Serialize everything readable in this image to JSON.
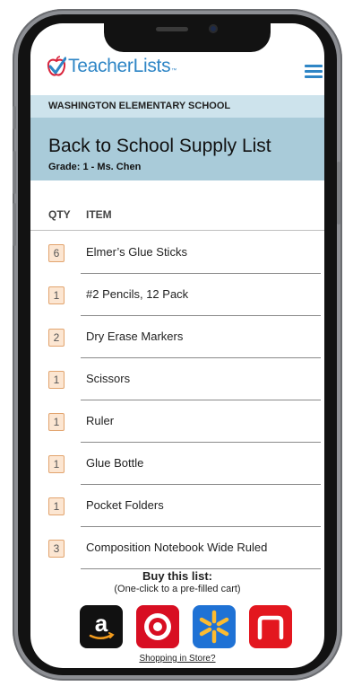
{
  "header": {
    "logo_name": "TeacherLists",
    "logo_tm": "™"
  },
  "school": "WASHINGTON ELEMENTARY SCHOOL",
  "list": {
    "title": "Back to School Supply List",
    "grade": "Grade: 1 - Ms. Chen"
  },
  "columns": {
    "qty": "QTY",
    "item": "ITEM"
  },
  "items": [
    {
      "qty": "6",
      "name": "Elmer’s Glue Sticks"
    },
    {
      "qty": "1",
      "name": "#2 Pencils, 12 Pack"
    },
    {
      "qty": "2",
      "name": "Dry Erase Markers"
    },
    {
      "qty": "1",
      "name": "Scissors"
    },
    {
      "qty": "1",
      "name": "Ruler"
    },
    {
      "qty": "1",
      "name": "Glue Bottle"
    },
    {
      "qty": "1",
      "name": "Pocket Folders"
    },
    {
      "qty": "3",
      "name": "Composition Notebook Wide Ruled"
    }
  ],
  "buy": {
    "title": "Buy this list:",
    "subtitle": "(One-click to a pre-filled cart)",
    "in_store_link": "Shopping in Store?"
  },
  "stores": [
    {
      "name": "amazon",
      "letter": "a",
      "color": "#111111"
    },
    {
      "name": "target",
      "color": "#d80e22"
    },
    {
      "name": "walmart",
      "color": "#1f72d5"
    },
    {
      "name": "kmart",
      "color": "#e3171f"
    }
  ],
  "colors": {
    "brand": "#2f86c6",
    "school_bar": "#cde3ec",
    "title_bar": "#a9cbd9",
    "qty_fill": "#fce6d2",
    "qty_border": "#e2a46e"
  },
  "icons": [
    "teacherlists-apple-logo",
    "hamburger-menu-icon",
    "amazon-icon",
    "target-icon",
    "walmart-icon",
    "kmart-icon"
  ]
}
